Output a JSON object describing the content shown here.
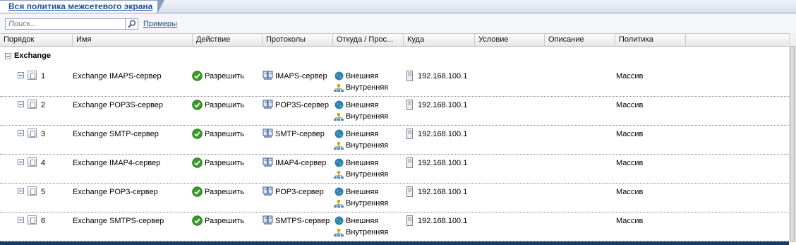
{
  "tab": {
    "title": "Вся политика межсетевого экрана"
  },
  "search": {
    "placeholder": "Поиск...",
    "value": "",
    "examples_link": "Примеры"
  },
  "columns": [
    {
      "key": "order",
      "label": "Порядок"
    },
    {
      "key": "name",
      "label": "Имя"
    },
    {
      "key": "action",
      "label": "Действие"
    },
    {
      "key": "protocols",
      "label": "Протоколы"
    },
    {
      "key": "from",
      "label": "Откуда / Прос..."
    },
    {
      "key": "to",
      "label": "Куда"
    },
    {
      "key": "condition",
      "label": "Условие"
    },
    {
      "key": "description",
      "label": "Описание"
    },
    {
      "key": "policy",
      "label": "Политика"
    }
  ],
  "group": {
    "title": "Exchange"
  },
  "rules": [
    {
      "order": "1",
      "name": "Exchange IMAPS-сервер",
      "action": "Разрешить",
      "protocol": "IMAPS-сервер",
      "from": [
        "Внешняя",
        "Внутренняя"
      ],
      "to": "192.168.100.1",
      "policy": "Массив"
    },
    {
      "order": "2",
      "name": "Exchange POP3S-сервер",
      "action": "Разрешить",
      "protocol": "POP3S-сервер",
      "from": [
        "Внешняя",
        "Внутренняя"
      ],
      "to": "192.168.100.1",
      "policy": "Массив"
    },
    {
      "order": "3",
      "name": "Exchange SMTP-сервер",
      "action": "Разрешить",
      "protocol": "SMTP-сервер",
      "from": [
        "Внешняя",
        "Внутренняя"
      ],
      "to": "192.168.100.1",
      "policy": "Массив"
    },
    {
      "order": "4",
      "name": "Exchange IMAP4-сервер",
      "action": "Разрешить",
      "protocol": "IMAP4-сервер",
      "from": [
        "Внешняя",
        "Внутренняя"
      ],
      "to": "192.168.100.1",
      "policy": "Массив"
    },
    {
      "order": "5",
      "name": "Exchange POP3-сервер",
      "action": "Разрешить",
      "protocol": "POP3-сервер",
      "from": [
        "Внешняя",
        "Внутренняя"
      ],
      "to": "192.168.100.1",
      "policy": "Массив"
    },
    {
      "order": "6",
      "name": "Exchange SMTPS-сервер",
      "action": "Разрешить",
      "protocol": "SMTPS-сервер",
      "from": [
        "Внешняя",
        "Внутренняя"
      ],
      "to": "192.168.100.1",
      "policy": "Массив"
    }
  ],
  "icons": {
    "search": "magnifier-icon",
    "collapse": "minus-box-icon",
    "rule": "rule-document-icon",
    "allow": "green-check-icon",
    "protocol": "protocol-icon",
    "external": "globe-icon",
    "internal": "network-icon",
    "address": "server-icon"
  },
  "colors": {
    "link": "#1f4e9a",
    "allow_green": "#3a9a2a",
    "bottom_bar": "#173a6d"
  }
}
